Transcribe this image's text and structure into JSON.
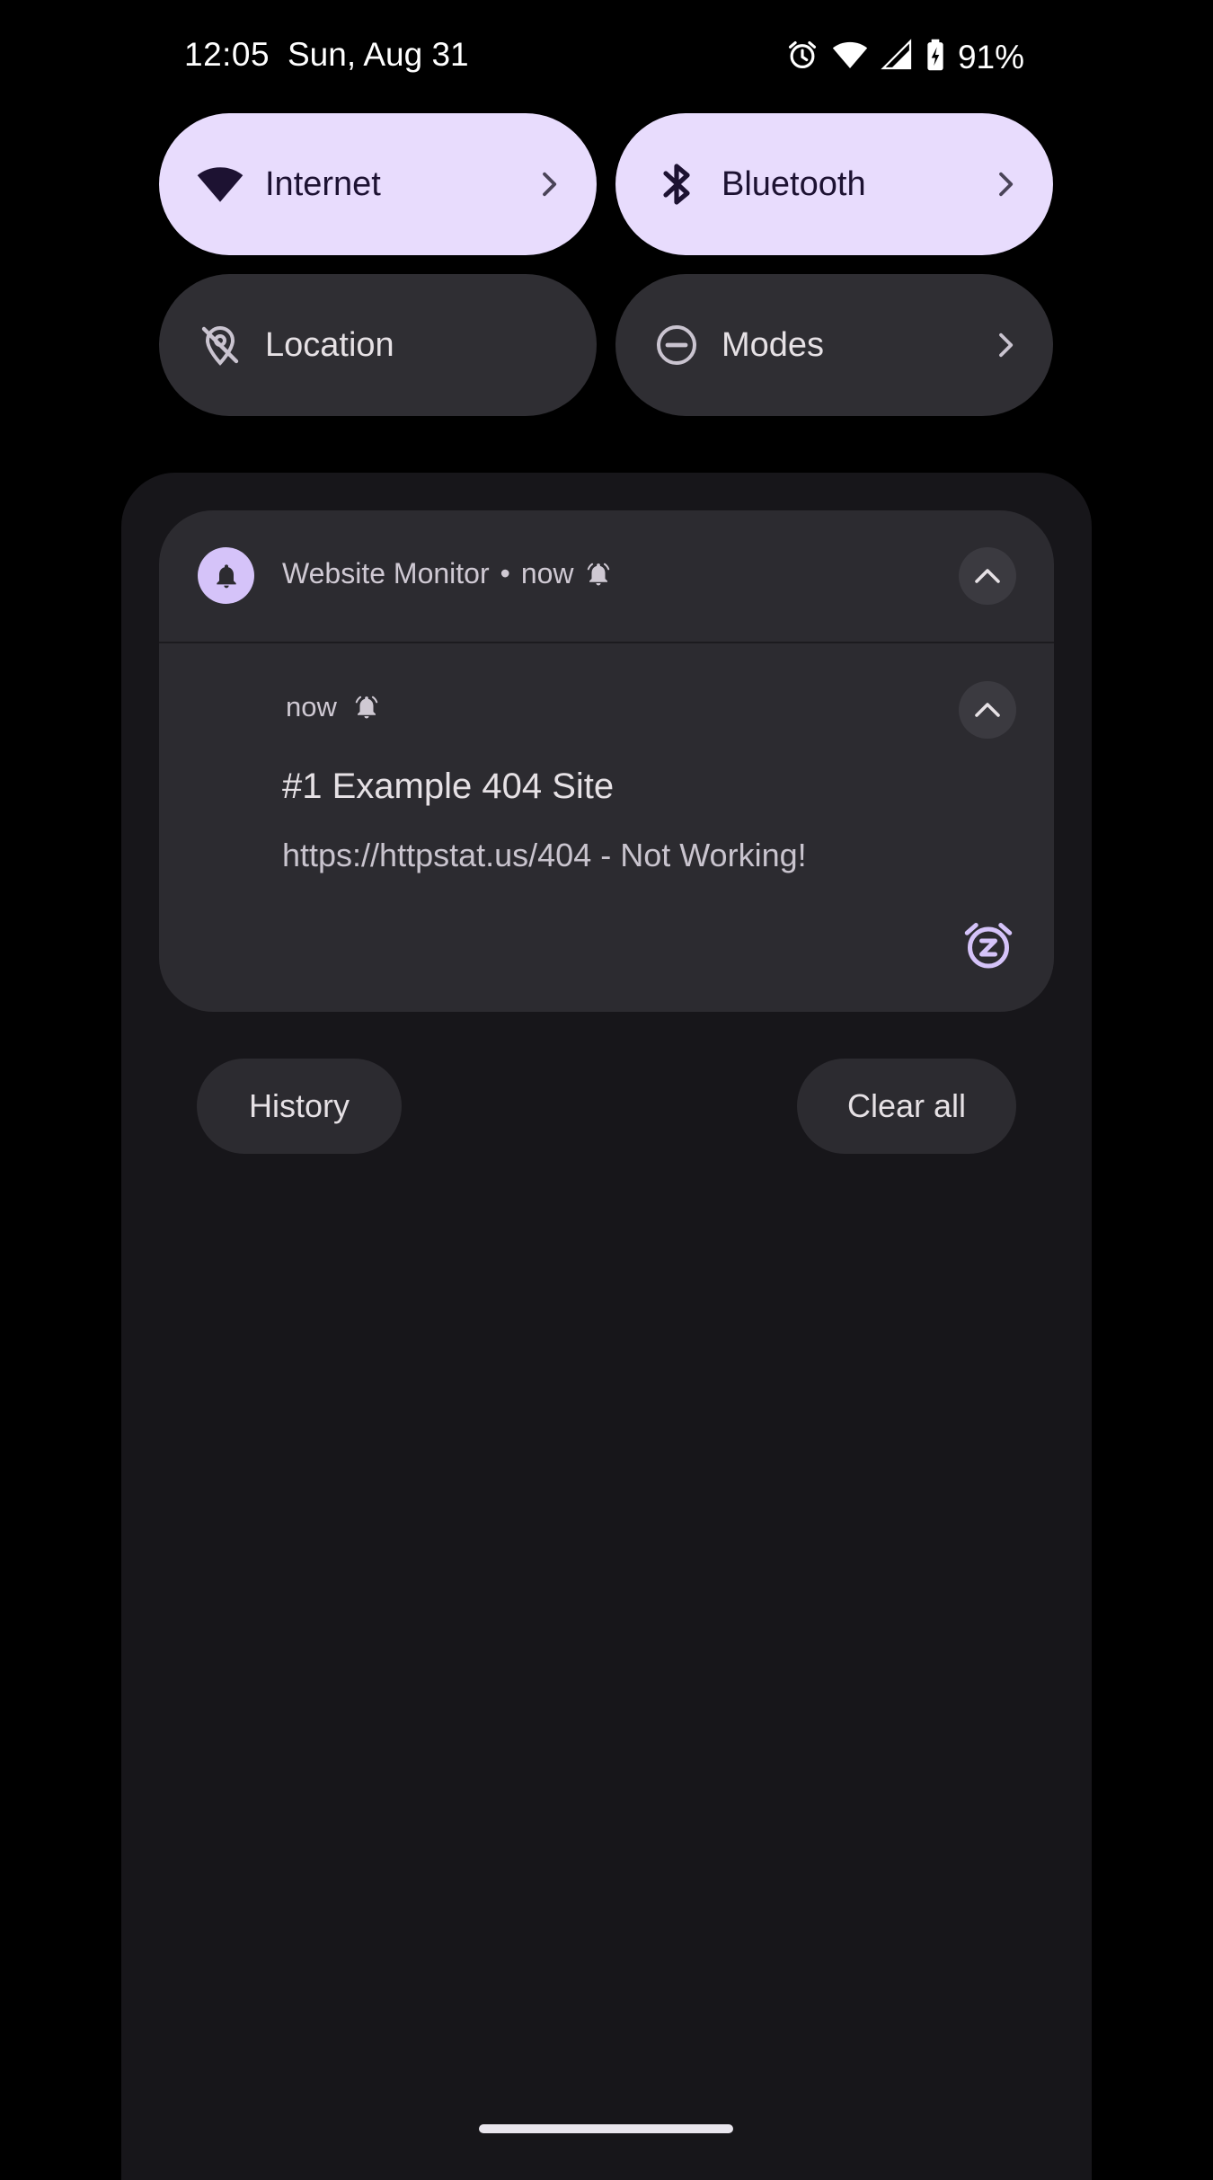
{
  "status_bar": {
    "time": "12:05",
    "date": "Sun, Aug 31",
    "battery_percent": "91%",
    "icons": [
      "alarm-icon",
      "wifi-icon",
      "cell-signal-icon",
      "battery-charging-icon"
    ]
  },
  "quick_tiles": [
    {
      "label": "Internet",
      "icon": "wifi-icon",
      "state": "on",
      "has_chevron": true
    },
    {
      "label": "Bluetooth",
      "icon": "bluetooth-icon",
      "state": "on",
      "has_chevron": true
    },
    {
      "label": "Location",
      "icon": "location-off-icon",
      "state": "off",
      "has_chevron": false
    },
    {
      "label": "Modes",
      "icon": "do-not-disturb-icon",
      "state": "off",
      "has_chevron": true
    }
  ],
  "notification": {
    "app_name": "Website Monitor",
    "separator": "•",
    "time": "now",
    "sub_time": "now",
    "title": "#1 Example 404 Site",
    "body": "https://httpstat.us/404 - Not Working!"
  },
  "actions": {
    "history": "History",
    "clear_all": "Clear all"
  },
  "colors": {
    "tile_on": "#e8dcfd",
    "tile_off": "#2f2e33",
    "accent": "#d5c3f9",
    "shade": "#17161a",
    "card": "#2c2b30"
  }
}
